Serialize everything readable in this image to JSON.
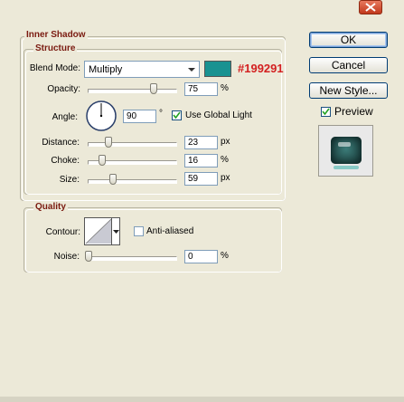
{
  "dialog": {
    "close_glyph": "✕",
    "section_title": "Inner Shadow"
  },
  "structure": {
    "legend": "Structure",
    "blend_mode_label": "Blend Mode:",
    "blend_mode_value": "Multiply",
    "color_swatch": "#199291",
    "color_annotation": "#199291",
    "opacity_label": "Opacity:",
    "opacity_value": "75",
    "opacity_fraction": 0.75,
    "opacity_unit": "%",
    "angle_label": "Angle:",
    "angle_value": "90",
    "angle_unit": "°",
    "use_global_light_label": "Use Global Light",
    "use_global_light_checked": true,
    "distance_label": "Distance:",
    "distance_value": "23",
    "distance_unit": "px",
    "choke_label": "Choke:",
    "choke_value": "16",
    "choke_unit": "%",
    "size_label": "Size:",
    "size_value": "59",
    "size_unit": "px"
  },
  "quality": {
    "legend": "Quality",
    "contour_label": "Contour:",
    "anti_aliased_label": "Anti-aliased",
    "anti_aliased_checked": false,
    "noise_label": "Noise:",
    "noise_value": "0",
    "noise_unit": "%"
  },
  "buttons": {
    "ok": "OK",
    "cancel": "Cancel",
    "new_style": "New Style...",
    "preview_label": "Preview",
    "preview_checked": true
  }
}
